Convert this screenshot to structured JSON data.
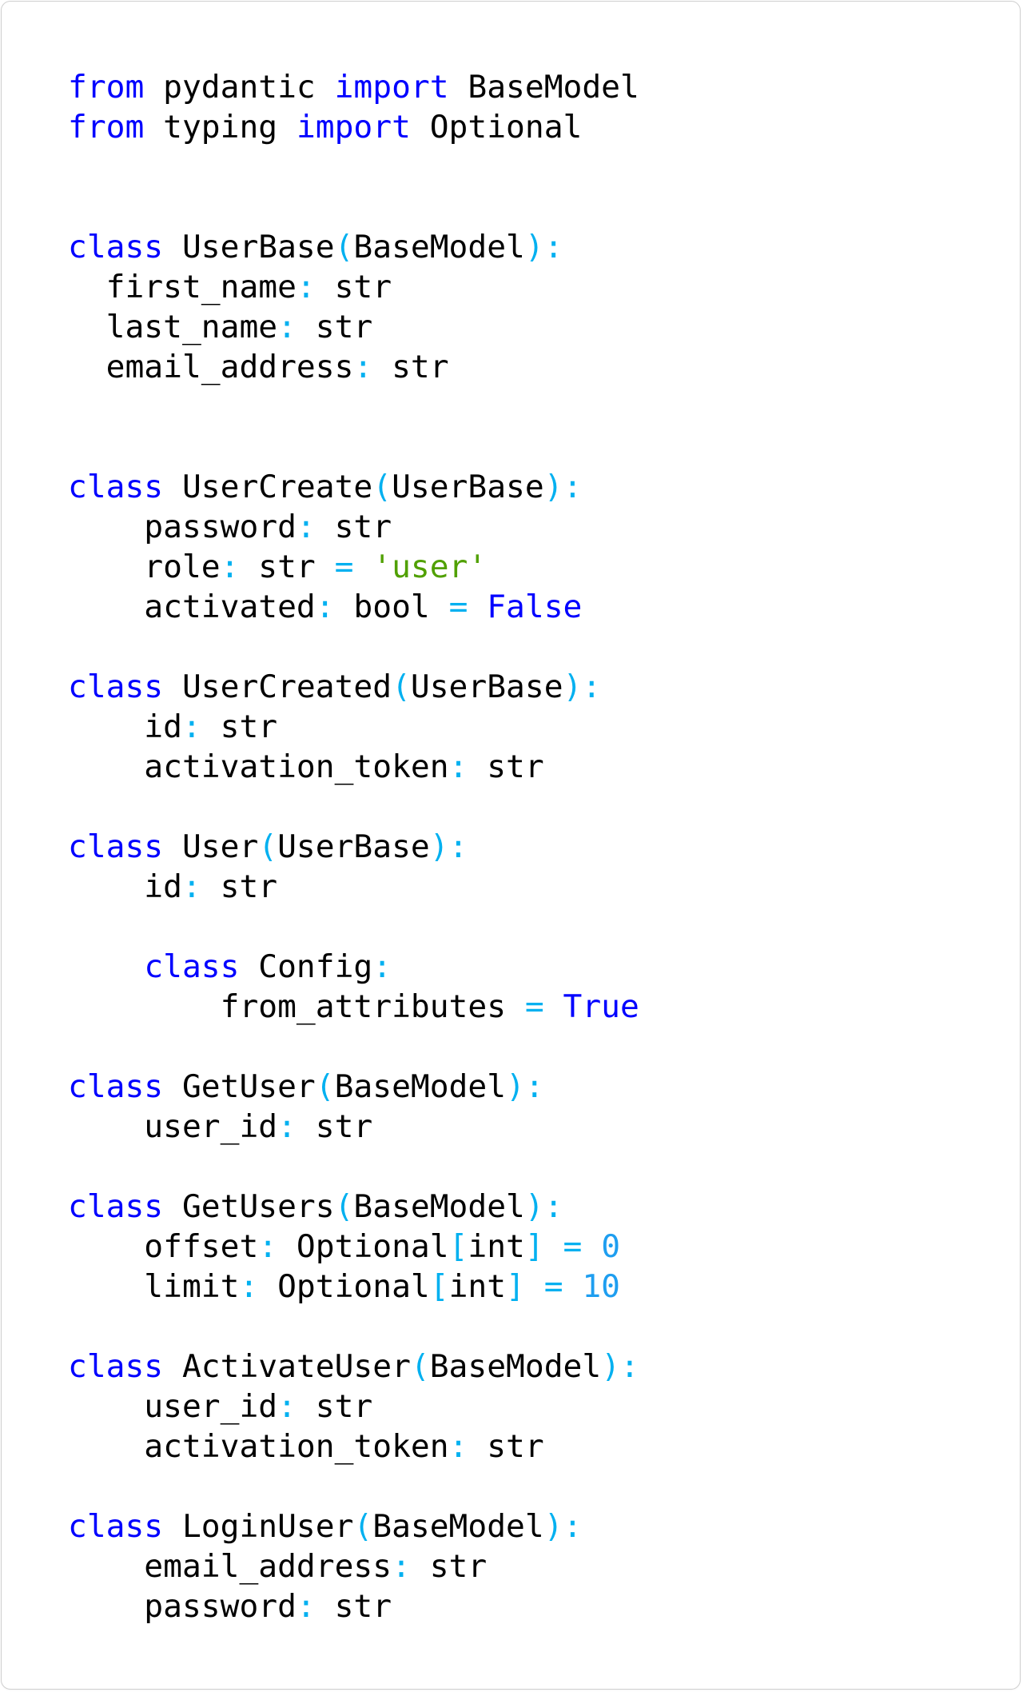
{
  "theme": {
    "keyword_color": "#0000ff",
    "punctuation_color": "#00b0f0",
    "string_color": "#50a000",
    "number_color": "#1e9ef0",
    "text_color": "#000000",
    "background_color": "#ffffff",
    "border_color": "#cfcfcf"
  },
  "code": {
    "language": "python",
    "lines": [
      [
        [
          "kw",
          "from"
        ],
        [
          "plain",
          " pydantic "
        ],
        [
          "kw",
          "import"
        ],
        [
          "plain",
          " BaseModel"
        ]
      ],
      [
        [
          "kw",
          "from"
        ],
        [
          "plain",
          " typing "
        ],
        [
          "kw",
          "import"
        ],
        [
          "plain",
          " Optional"
        ]
      ],
      [],
      [],
      [
        [
          "kw",
          "class"
        ],
        [
          "plain",
          " UserBase"
        ],
        [
          "op",
          "("
        ],
        [
          "plain",
          "BaseModel"
        ],
        [
          "op",
          "):"
        ]
      ],
      [
        [
          "plain",
          "  first_name"
        ],
        [
          "op",
          ":"
        ],
        [
          "plain",
          " str"
        ]
      ],
      [
        [
          "plain",
          "  last_name"
        ],
        [
          "op",
          ":"
        ],
        [
          "plain",
          " str"
        ]
      ],
      [
        [
          "plain",
          "  email_address"
        ],
        [
          "op",
          ":"
        ],
        [
          "plain",
          " str"
        ]
      ],
      [],
      [],
      [
        [
          "kw",
          "class"
        ],
        [
          "plain",
          " UserCreate"
        ],
        [
          "op",
          "("
        ],
        [
          "plain",
          "UserBase"
        ],
        [
          "op",
          "):"
        ]
      ],
      [
        [
          "plain",
          "    password"
        ],
        [
          "op",
          ":"
        ],
        [
          "plain",
          " str"
        ]
      ],
      [
        [
          "plain",
          "    role"
        ],
        [
          "op",
          ":"
        ],
        [
          "plain",
          " str "
        ],
        [
          "op",
          "="
        ],
        [
          "plain",
          " "
        ],
        [
          "str",
          "'user'"
        ]
      ],
      [
        [
          "plain",
          "    activated"
        ],
        [
          "op",
          ":"
        ],
        [
          "plain",
          " bool "
        ],
        [
          "op",
          "="
        ],
        [
          "plain",
          " "
        ],
        [
          "kw",
          "False"
        ]
      ],
      [],
      [
        [
          "kw",
          "class"
        ],
        [
          "plain",
          " UserCreated"
        ],
        [
          "op",
          "("
        ],
        [
          "plain",
          "UserBase"
        ],
        [
          "op",
          "):"
        ]
      ],
      [
        [
          "plain",
          "    id"
        ],
        [
          "op",
          ":"
        ],
        [
          "plain",
          " str"
        ]
      ],
      [
        [
          "plain",
          "    activation_token"
        ],
        [
          "op",
          ":"
        ],
        [
          "plain",
          " str"
        ]
      ],
      [],
      [
        [
          "kw",
          "class"
        ],
        [
          "plain",
          " User"
        ],
        [
          "op",
          "("
        ],
        [
          "plain",
          "UserBase"
        ],
        [
          "op",
          "):"
        ]
      ],
      [
        [
          "plain",
          "    id"
        ],
        [
          "op",
          ":"
        ],
        [
          "plain",
          " str"
        ]
      ],
      [],
      [
        [
          "plain",
          "    "
        ],
        [
          "kw",
          "class"
        ],
        [
          "plain",
          " Config"
        ],
        [
          "op",
          ":"
        ]
      ],
      [
        [
          "plain",
          "        from_attributes "
        ],
        [
          "op",
          "="
        ],
        [
          "plain",
          " "
        ],
        [
          "kw",
          "True"
        ]
      ],
      [],
      [
        [
          "kw",
          "class"
        ],
        [
          "plain",
          " GetUser"
        ],
        [
          "op",
          "("
        ],
        [
          "plain",
          "BaseModel"
        ],
        [
          "op",
          "):"
        ]
      ],
      [
        [
          "plain",
          "    user_id"
        ],
        [
          "op",
          ":"
        ],
        [
          "plain",
          " str"
        ]
      ],
      [],
      [
        [
          "kw",
          "class"
        ],
        [
          "plain",
          " GetUsers"
        ],
        [
          "op",
          "("
        ],
        [
          "plain",
          "BaseModel"
        ],
        [
          "op",
          "):"
        ]
      ],
      [
        [
          "plain",
          "    offset"
        ],
        [
          "op",
          ":"
        ],
        [
          "plain",
          " Optional"
        ],
        [
          "op",
          "["
        ],
        [
          "plain",
          "int"
        ],
        [
          "op",
          "]"
        ],
        [
          "plain",
          " "
        ],
        [
          "op",
          "="
        ],
        [
          "plain",
          " "
        ],
        [
          "num",
          "0"
        ]
      ],
      [
        [
          "plain",
          "    limit"
        ],
        [
          "op",
          ":"
        ],
        [
          "plain",
          " Optional"
        ],
        [
          "op",
          "["
        ],
        [
          "plain",
          "int"
        ],
        [
          "op",
          "]"
        ],
        [
          "plain",
          " "
        ],
        [
          "op",
          "="
        ],
        [
          "plain",
          " "
        ],
        [
          "num",
          "10"
        ]
      ],
      [],
      [
        [
          "kw",
          "class"
        ],
        [
          "plain",
          " ActivateUser"
        ],
        [
          "op",
          "("
        ],
        [
          "plain",
          "BaseModel"
        ],
        [
          "op",
          "):"
        ]
      ],
      [
        [
          "plain",
          "    user_id"
        ],
        [
          "op",
          ":"
        ],
        [
          "plain",
          " str"
        ]
      ],
      [
        [
          "plain",
          "    activation_token"
        ],
        [
          "op",
          ":"
        ],
        [
          "plain",
          " str"
        ]
      ],
      [],
      [
        [
          "kw",
          "class"
        ],
        [
          "plain",
          " LoginUser"
        ],
        [
          "op",
          "("
        ],
        [
          "plain",
          "BaseModel"
        ],
        [
          "op",
          "):"
        ]
      ],
      [
        [
          "plain",
          "    email_address"
        ],
        [
          "op",
          ":"
        ],
        [
          "plain",
          " str"
        ]
      ],
      [
        [
          "plain",
          "    password"
        ],
        [
          "op",
          ":"
        ],
        [
          "plain",
          " str"
        ]
      ]
    ]
  }
}
